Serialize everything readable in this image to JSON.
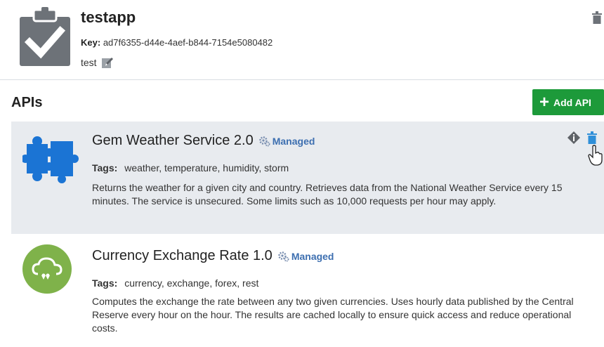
{
  "app": {
    "name": "testapp",
    "key_label": "Key:",
    "key_value": "ad7f6355-d44e-4aef-b844-7154e5080482",
    "description": "test"
  },
  "apis": {
    "title": "APIs",
    "add_button_label": "Add API",
    "tags_label": "Tags:",
    "items": [
      {
        "name": "Gem Weather Service 2.0",
        "badge": "Managed",
        "tags": "weather, temperature, humidity, storm",
        "description": "Returns the weather for a given city and country. Retrieves data from the National Weather Service every 15 minutes. The service is unsecured. Some limits such as 10,000 requests per hour may apply.",
        "icon": "puzzle-icon",
        "selected": true
      },
      {
        "name": "Currency Exchange Rate 1.0",
        "badge": "Managed",
        "tags": "currency, exchange, forex, rest",
        "description": "Computes the exchange the rate between any two given currencies. Uses hourly data published by the Central Reserve every hour on the hour. The results are cached locally to ensure quick access and reduce operational costs.",
        "icon": "cloud-icon",
        "selected": false
      }
    ]
  },
  "colors": {
    "accent_green": "#1d9a3a",
    "managed_blue": "#3d6fb0",
    "puzzle_blue": "#1b74d4",
    "cloud_green": "#7fb24a",
    "selected_bg": "#e8ebef"
  }
}
